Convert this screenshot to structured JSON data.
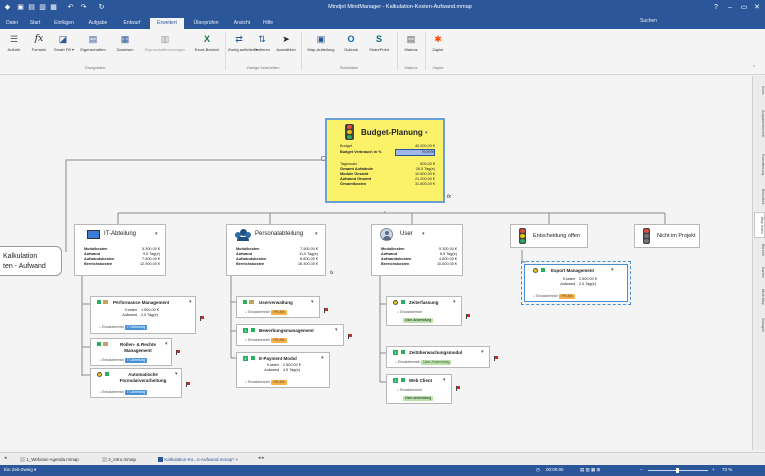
{
  "window": {
    "title": "Mindjet MindManager - Kalkulation-Kosten-Aufwand.mmap",
    "controls": [
      "?",
      "–",
      "▭",
      "✕"
    ]
  },
  "ribbon_tabs": [
    "Datei",
    "Start",
    "Einfügen",
    "Aufgabe",
    "Entwurf",
    "Erweitert",
    "Überprüfen",
    "Ansicht",
    "Hilfe"
  ],
  "active_tab": "Erweitert",
  "search_label": "Suchen",
  "ribbon": {
    "buttons": [
      {
        "id": "aufrufe",
        "label": "Aufrufe",
        "icon": "sliders-icon"
      },
      {
        "id": "formeln",
        "label": "Formeln",
        "icon": "fx-icon"
      },
      {
        "id": "smartfill",
        "label": "Smart Fill ▾",
        "icon": "bucket-icon"
      },
      {
        "id": "eigenschaften",
        "label": "Eigenschaften",
        "icon": "properties-icon"
      },
      {
        "id": "zuweisen",
        "label": "Zuweisen",
        "icon": "assign-icon"
      },
      {
        "id": "vorlagen",
        "label": "Eigenschaftenvorlagen",
        "icon": "template-icon",
        "disabled": true
      },
      {
        "id": "excel",
        "label": "Excel-Bereich",
        "icon": "excel-icon"
      },
      {
        "id": "zweig",
        "label": "Zweig aufteilen ▾",
        "icon": "split-icon"
      },
      {
        "id": "sortieren",
        "label": "Sortieren",
        "icon": "sort-icon"
      },
      {
        "id": "auswahlen",
        "label": "Auswählen",
        "icon": "cursor-icon"
      },
      {
        "id": "mapaufteilung",
        "label": "Map-Aufteilung",
        "icon": "map-split-icon"
      },
      {
        "id": "outlook",
        "label": "Outlook",
        "icon": "outlook-icon"
      },
      {
        "id": "sharepoint",
        "label": "SharePoint",
        "icon": "sharepoint-icon"
      },
      {
        "id": "makros",
        "label": "Makros",
        "icon": "macro-icon"
      },
      {
        "id": "zapier",
        "label": "Zapier",
        "icon": "zapier-icon"
      }
    ],
    "groups": [
      "Zweigdaten",
      "Zweige bearbeiten",
      "Startdaten",
      "Makros",
      "Zapier"
    ]
  },
  "central": {
    "title": "Budget-Planung",
    "rows": [
      {
        "k": "Budget",
        "v": "40.000,00 €"
      },
      {
        "k": "Budget Verbrauch in %",
        "v": "79,50%"
      },
      {
        "k": "Tagessatz",
        "v": "800,00 €"
      },
      {
        "k": "Gesamt Aufwände",
        "v": "26,5 Tag(e)"
      },
      {
        "k": "Module Gesamt",
        "v": "10.600,00 €"
      },
      {
        "k": "Aufwand Gesamt",
        "v": "21.200,00 €"
      },
      {
        "k": "Gesamtkosten",
        "v": "31.800,00 €"
      }
    ]
  },
  "left_floating": {
    "line1": "Kalkulation",
    "line2": "ten - Aufwand"
  },
  "branches": [
    {
      "title": "IT-Abteilung",
      "icon": "monitor-icon",
      "rows": [
        {
          "k": "Modulkosten",
          "v": "5.300,00 €"
        },
        {
          "k": "Aufwand",
          "v": "9,5 Tag(e)"
        },
        {
          "k": "Aufwandskosten",
          "v": "7.600,00 €"
        },
        {
          "k": "Bereichskosten",
          "v": "12.900,00 €"
        }
      ],
      "children": [
        {
          "title": "Performance Management",
          "rows": [
            {
              "k": "Kosten",
              "v": "1.500,00 €"
            },
            {
              "k": "Aufwand",
              "v": "2,5 Tag(e)"
            }
          ],
          "chip_label": "Einsatzbereich",
          "chip": "IT-Abteilung"
        },
        {
          "title": "Rollen- & Rechte Management",
          "rows": [],
          "chip_label": "Einsatzbereich",
          "chip": "IT-Abteilung"
        },
        {
          "title": "Automatische Formularverarbeitung",
          "rows": [],
          "chip_label": "Einsatzbereich",
          "chip": "IT-Abteilung"
        }
      ]
    },
    {
      "title": "Personalabteilung",
      "icon": "people-icon",
      "rows": [
        {
          "k": "Modulkosten",
          "v": "7.500,00 €"
        },
        {
          "k": "Aufwand",
          "v": "11,0 Tag(e)"
        },
        {
          "k": "Aufwandskosten",
          "v": "8.800,00 €"
        },
        {
          "k": "Bereichskosten",
          "v": "16.300,00 €"
        }
      ],
      "children": [
        {
          "title": "Userverwaltung",
          "rows": [],
          "chip_label": "Einsatzbereich",
          "chip": "HR-Abt."
        },
        {
          "title": "Bewerbungsmanagement",
          "rows": [],
          "chip_label": "Einsatzbereich",
          "chip": "HR-Abt."
        },
        {
          "title": "E-Payment Modul",
          "rows": [
            {
              "k": "Kosten",
              "v": "2.500,00 €"
            },
            {
              "k": "Aufwand",
              "v": "4,5 Tag(e)"
            }
          ],
          "chip_label": "Einsatzbereich",
          "chip": "HR-Abt."
        }
      ]
    },
    {
      "title": "User",
      "icon": "user-icon",
      "rows": [
        {
          "k": "Modulkosten",
          "v": "5.300,00 €"
        },
        {
          "k": "Aufwand",
          "v": "6,5 Tag(e)"
        },
        {
          "k": "Aufwandskosten",
          "v": "4.800,00 €"
        },
        {
          "k": "Bereichskosten",
          "v": "10.600,00 €"
        }
      ],
      "children": [
        {
          "title": "Zeiterfassung",
          "rows": [],
          "chip_label": "Einsatzbereich",
          "chip": "User-Anwendung"
        },
        {
          "title": "Zeitüberwachungsmodul",
          "rows": [],
          "chip_label": "Einsatzbereich",
          "chip": "User-Anwendung"
        },
        {
          "title": "Web Client",
          "rows": [],
          "chip_label": "Einsatzbereich",
          "chip": "User-Anwendung"
        }
      ]
    }
  ],
  "decision": {
    "title": "Entscheidung offen",
    "child": {
      "title": "Export Management",
      "rows": [
        {
          "k": "Kosten",
          "v": "2.500,00 €"
        },
        {
          "k": "Aufwand",
          "v": "2,5 Tag(e)"
        }
      ],
      "chip_label": "Einsatzbereich",
      "chip": "HR-Abt."
    }
  },
  "not_in_project": {
    "title": "Nicht im Projekt"
  },
  "side_tabs": [
    "Icons",
    "Aufgabenbereich",
    "Formatierung",
    "Bibliothek",
    "Map Index",
    "Bereich",
    "Karten",
    "Multi-Map",
    "Vorlagen"
  ],
  "doc_tabs": [
    {
      "label": "1_Webinar-Agenda.mmap",
      "active": false
    },
    {
      "label": "2_Intro.mmap",
      "active": false
    },
    {
      "label": "Kalkulation-Ko...n-Aufwand.mmap*",
      "active": true
    }
  ],
  "status": {
    "left": "Ein Zeit-Zweig ▾",
    "time": "00:00:00",
    "zoom": "73 %"
  },
  "colors": {
    "accent": "#2b579a",
    "central_bg": "#fbf26a",
    "it_chip": "#4a8fd4",
    "hr_chip": "#f5b14a",
    "user_chip": "#b8e2a8"
  }
}
